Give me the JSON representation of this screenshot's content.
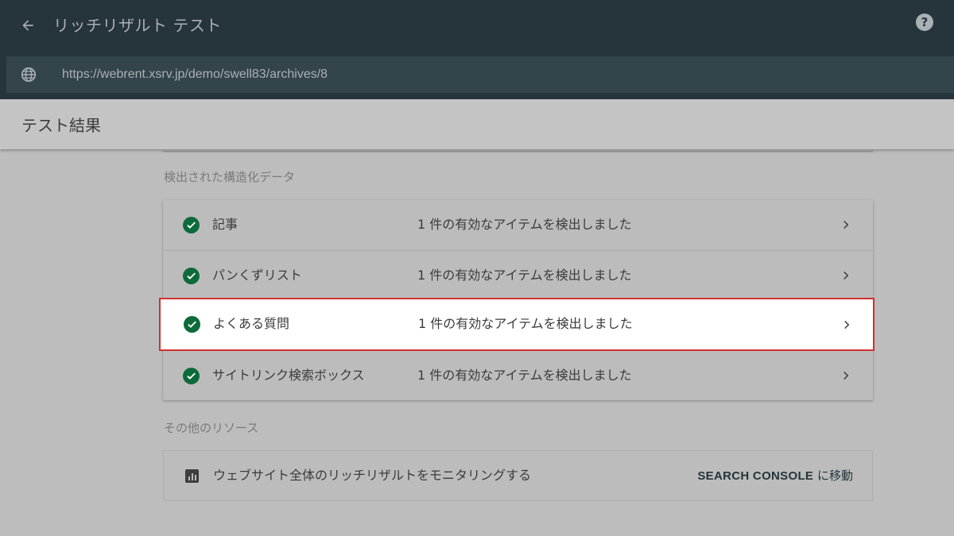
{
  "header": {
    "title": "リッチリザルト テスト",
    "url": "https://webrent.xsrv.jp/demo/swell83/archives/8"
  },
  "results": {
    "title": "テスト結果"
  },
  "structured_data": {
    "section_label": "検出された構造化データ",
    "items": [
      {
        "name": "記事",
        "status": "1 件の有効なアイテムを検出しました"
      },
      {
        "name": "パンくずリスト",
        "status": "1 件の有効なアイテムを検出しました"
      },
      {
        "name": "よくある質問",
        "status": "1 件の有効なアイテムを検出しました"
      },
      {
        "name": "サイトリンク検索ボックス",
        "status": "1 件の有効なアイテムを検出しました"
      }
    ]
  },
  "other_resources": {
    "section_label": "その他のリソース",
    "text": "ウェブサイト全体のリッチリザルトをモニタリングする",
    "link_strong": "SEARCH CONSOLE",
    "link_rest": " に移動"
  },
  "icons": {
    "back": "arrow-back-icon",
    "help": "help-icon",
    "url": "globe-icon",
    "status": "check-circle-icon",
    "row_action": "chevron-right-icon",
    "resource": "bar-chart-icon"
  },
  "colors": {
    "topbar": "#26343b",
    "urlbar": "#34444b",
    "check": "#0d6a3a",
    "highlight_border": "#d32f2f"
  }
}
